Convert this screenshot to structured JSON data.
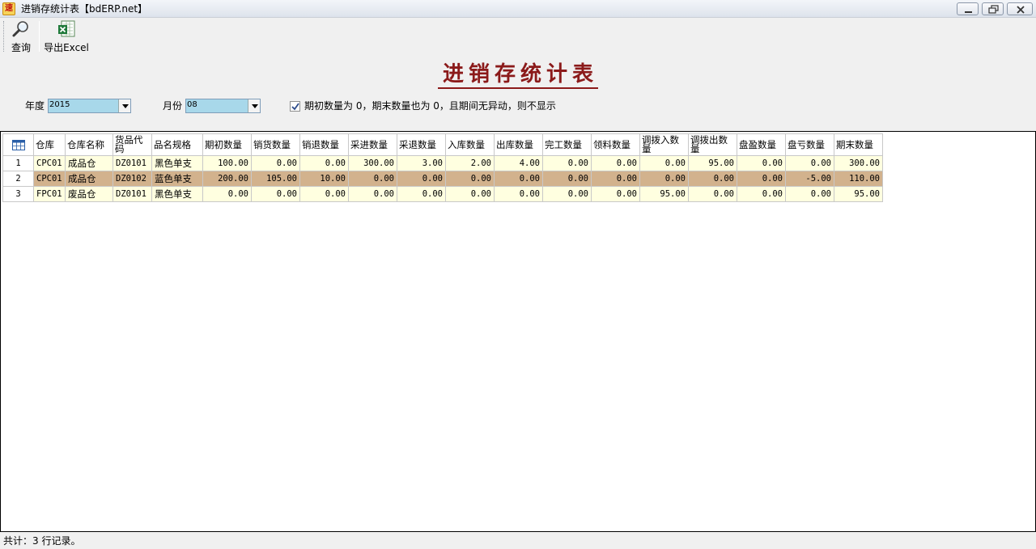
{
  "window": {
    "title": "进销存统计表【bdERP.net】",
    "app_icon_glyph": "速"
  },
  "toolbar": {
    "query_label": "查询",
    "export_label": "导出Excel"
  },
  "report": {
    "title": "进销存统计表"
  },
  "filters": {
    "year_label": "年度",
    "year_value": "2015",
    "month_label": "月份",
    "month_value": "08",
    "hide_zero_checked": true,
    "hide_zero_label": "期初数量为 0，期末数量也为 0，且期间无异动，则不显示"
  },
  "grid": {
    "columns": [
      "仓库",
      "仓库名称",
      "货品代码",
      "品名规格",
      "期初数量",
      "销货数量",
      "销退数量",
      "采进数量",
      "采退数量",
      "入库数量",
      "出库数量",
      "完工数量",
      "领料数量",
      "调拨入数量",
      "调拨出数量",
      "盘盈数量",
      "盘亏数量",
      "期末数量"
    ],
    "rows": [
      {
        "no": "1",
        "cells": [
          "CPC01",
          "成品仓",
          "DZ0101",
          "黑色单支",
          "100.00",
          "0.00",
          "0.00",
          "300.00",
          "3.00",
          "2.00",
          "4.00",
          "0.00",
          "0.00",
          "0.00",
          "95.00",
          "0.00",
          "0.00",
          "300.00"
        ]
      },
      {
        "no": "2",
        "cells": [
          "CPC01",
          "成品仓",
          "DZ0102",
          "蓝色单支",
          "200.00",
          "105.00",
          "10.00",
          "0.00",
          "0.00",
          "0.00",
          "0.00",
          "0.00",
          "0.00",
          "0.00",
          "0.00",
          "0.00",
          "-5.00",
          "110.00"
        ]
      },
      {
        "no": "3",
        "cells": [
          "FPC01",
          "废品仓",
          "DZ0101",
          "黑色单支",
          "0.00",
          "0.00",
          "0.00",
          "0.00",
          "0.00",
          "0.00",
          "0.00",
          "0.00",
          "0.00",
          "95.00",
          "0.00",
          "0.00",
          "0.00",
          "95.00"
        ]
      }
    ]
  },
  "status": {
    "text": "共计：3 行记录。"
  },
  "colors": {
    "row_light": "#ffffe0",
    "row_dark": "#d2b28d",
    "title_red": "#8b1a1a",
    "combo_fill": "#a8d8ea"
  },
  "icons": {
    "query": "magnifier-icon",
    "export": "excel-icon",
    "grid_corner": "table-icon"
  }
}
